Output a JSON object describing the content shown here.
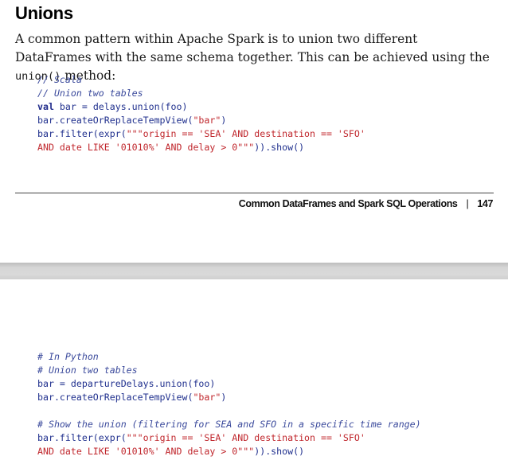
{
  "heading": "Unions",
  "para": {
    "text_before": "A common pattern within Apache Spark is to union two different DataFrames with the same schema together. This can be achieved using the ",
    "code": "union()",
    "text_after": " method:"
  },
  "scala_code": {
    "comment1": "// Scala",
    "comment2": "// Union two tables",
    "line3_kw": "val",
    "line3_rest": " bar = delays.union(foo)",
    "line4_fn": "bar.createOrReplaceTempView(",
    "line4_str": "\"bar\"",
    "line4_end": ")",
    "line5_fn": "bar.filter(expr(",
    "line5_str": "\"\"\"origin == 'SEA' AND destination == 'SFO'",
    "line6_str": "AND date LIKE '01010%' AND delay > 0\"\"\"",
    "line6_end": ")).show()"
  },
  "footer": {
    "title": "Common DataFrames and Spark SQL Operations",
    "separator": "|",
    "page_number": "147"
  },
  "python_code": {
    "comment1": "# In Python",
    "comment2": "# Union two tables",
    "line3": "bar = departureDelays.union(foo)",
    "line4_fn": "bar.createOrReplaceTempView(",
    "line4_str": "\"bar\"",
    "line4_end": ")",
    "comment3": "# Show the union (filtering for SEA and SFO in a specific time range)",
    "line6_fn": "bar.filter(expr(",
    "line6_str": "\"\"\"origin == 'SEA' AND destination == 'SFO'",
    "line7_str": "AND date LIKE '01010%' AND delay > 0\"\"\"",
    "line7_end": ")).show()"
  }
}
